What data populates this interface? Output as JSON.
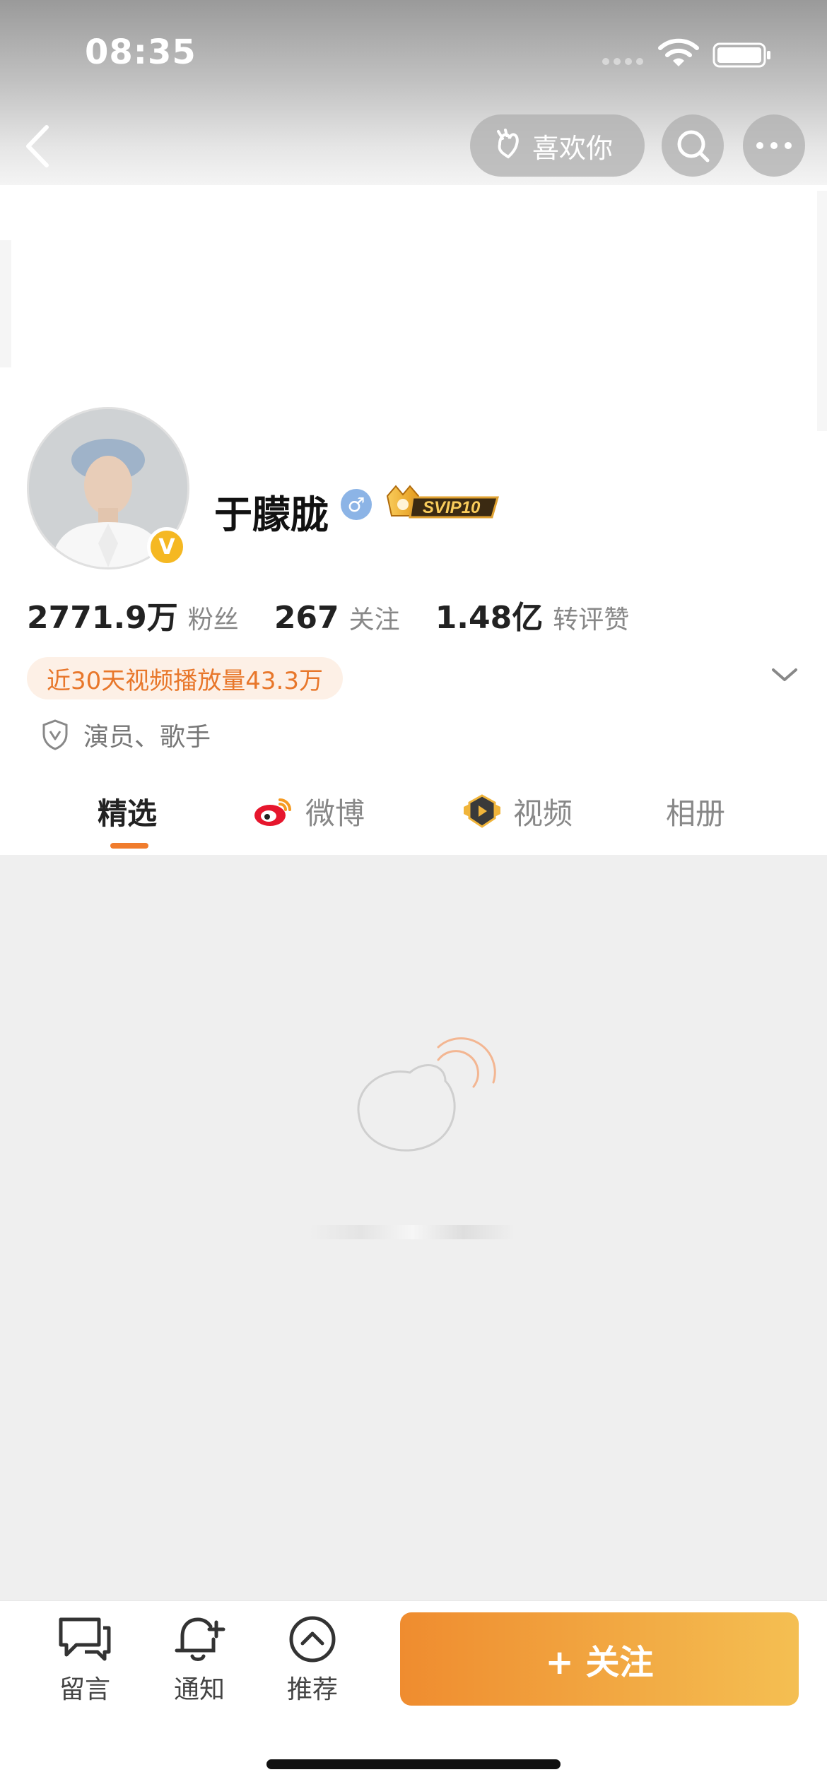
{
  "status_bar": {
    "time": "08:35"
  },
  "top_nav": {
    "like_label": "喜欢你"
  },
  "profile": {
    "name": "于朦胧",
    "verified_badge": "V",
    "gender_symbol": "♂",
    "svip_label": "SVIP10",
    "stats": [
      {
        "value": "2771.9万",
        "label": "粉丝"
      },
      {
        "value": "267",
        "label": "关注"
      },
      {
        "value": "1.48亿",
        "label": "转评赞"
      }
    ],
    "play_count": "近30天视频播放量43.3万",
    "auth_text": "演员、歌手"
  },
  "tabs": [
    {
      "label": "精选",
      "active": true
    },
    {
      "label": "微博",
      "active": false
    },
    {
      "label": "视频",
      "active": false
    },
    {
      "label": "相册",
      "active": false
    }
  ],
  "bottom_bar": {
    "message_label": "留言",
    "notify_label": "通知",
    "recommend_label": "推荐",
    "follow_label": "+ 关注"
  },
  "colors": {
    "accent_orange": "#f07c2d",
    "follow_gradient_start": "#ef8c2f",
    "follow_gradient_end": "#f4bf52",
    "verified_gold": "#f5b822",
    "gender_blue": "#8cb4e6"
  }
}
